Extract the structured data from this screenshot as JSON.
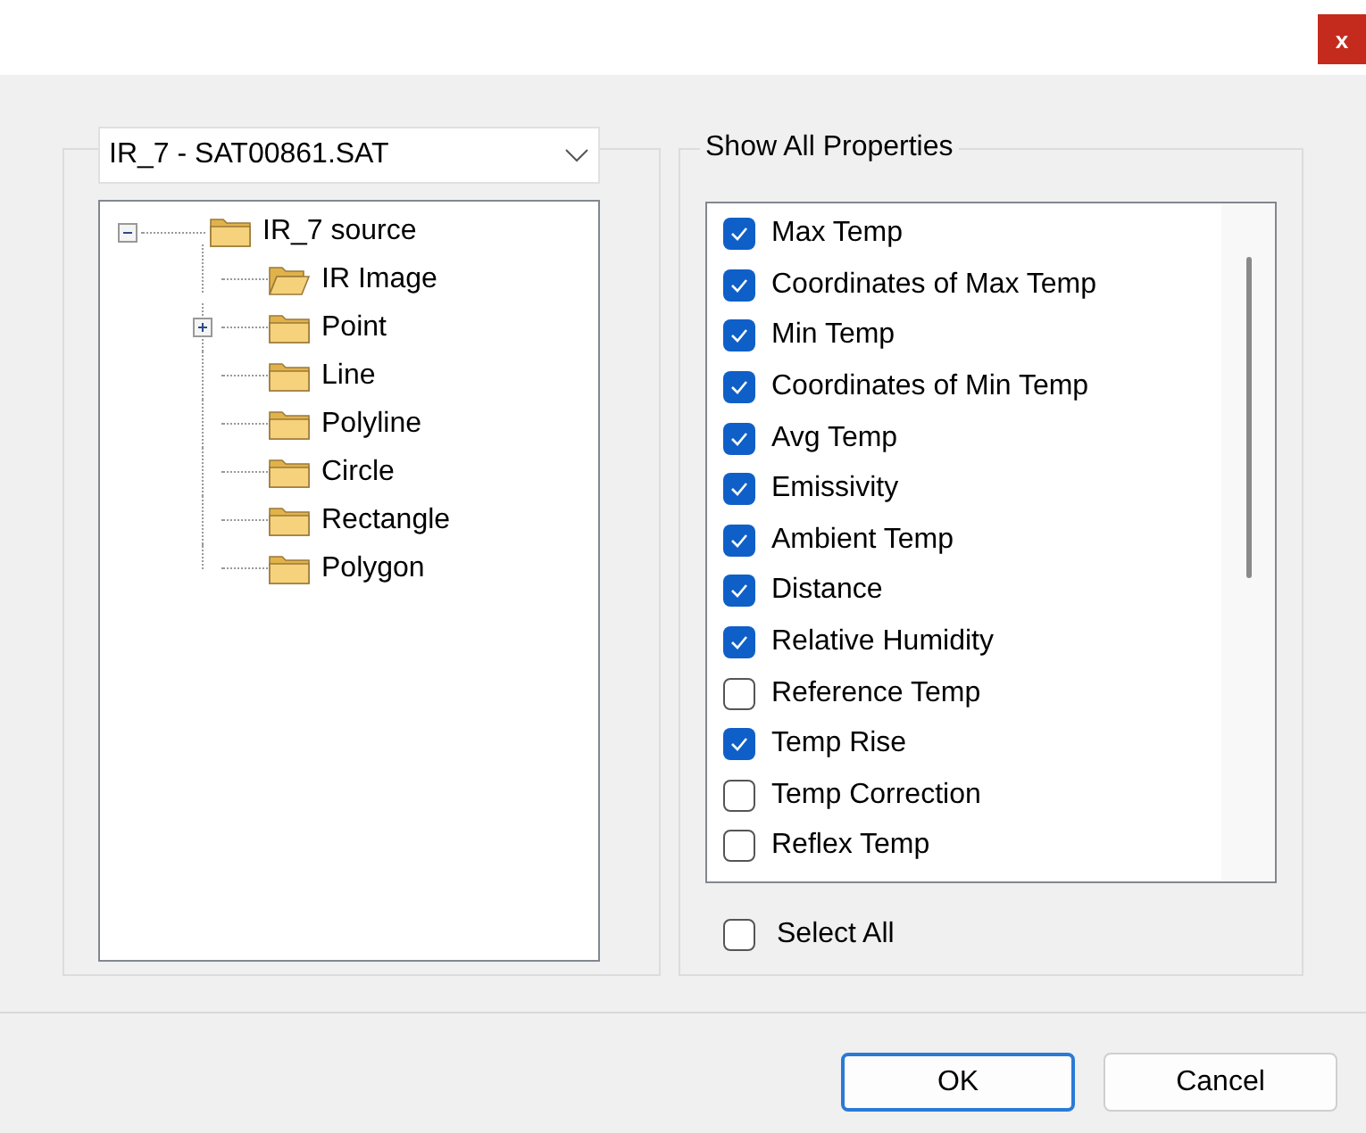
{
  "window": {
    "close": "x"
  },
  "source": {
    "value": "IR_7 - SAT00861.SAT"
  },
  "tree": [
    {
      "label": "IR_7 source",
      "expanded": true,
      "open": false,
      "children": [
        {
          "label": "IR Image",
          "open": true
        },
        {
          "label": "Point",
          "open": false,
          "expanded": false
        },
        {
          "label": "Line",
          "open": false
        },
        {
          "label": "Polyline",
          "open": false
        },
        {
          "label": "Circle",
          "open": false
        },
        {
          "label": "Rectangle",
          "open": false
        },
        {
          "label": "Polygon",
          "open": false
        }
      ]
    }
  ],
  "properties": {
    "title": "Show All Properties",
    "items": [
      {
        "label": "Max Temp",
        "checked": true
      },
      {
        "label": "Coordinates of Max Temp",
        "checked": true
      },
      {
        "label": "Min Temp",
        "checked": true
      },
      {
        "label": "Coordinates of Min Temp",
        "checked": true
      },
      {
        "label": "Avg Temp",
        "checked": true
      },
      {
        "label": "Emissivity",
        "checked": true
      },
      {
        "label": "Ambient Temp",
        "checked": true
      },
      {
        "label": "Distance",
        "checked": true
      },
      {
        "label": "Relative Humidity",
        "checked": true
      },
      {
        "label": "Reference Temp",
        "checked": false
      },
      {
        "label": "Temp Rise",
        "checked": true
      },
      {
        "label": "Temp Correction",
        "checked": false
      },
      {
        "label": "Reflex Temp",
        "checked": false
      }
    ],
    "select_all": {
      "label": "Select All",
      "checked": false
    }
  },
  "buttons": [
    {
      "label": "OK",
      "kind": "default"
    },
    {
      "label": "Cancel",
      "kind": "normal"
    }
  ]
}
